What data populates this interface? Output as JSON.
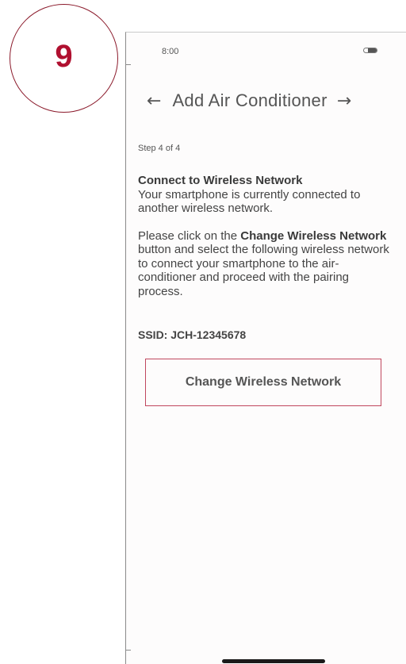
{
  "step_badge": {
    "number": "9"
  },
  "status_bar": {
    "time": "8:00"
  },
  "header": {
    "back_arrow": "←",
    "title": "Add Air Conditioner",
    "forward_arrow": "→"
  },
  "step_indicator": "Step 4 of 4",
  "content": {
    "heading": "Connect to Wireless Network",
    "intro": "Your smartphone is currently connected to another wireless network.",
    "para2_prefix": "Please click on the ",
    "para2_bold": "Change Wireless Network",
    "para2_suffix": " button and select the following wireless network to connect your smartphone to the air-conditioner and proceed with the pairing process."
  },
  "ssid": "SSID: JCH-12345678",
  "change_button_label": "Change Wireless Network",
  "colors": {
    "accent": "#b01030",
    "badge_border": "#8b1a2b",
    "button_border": "#c0475e"
  },
  "icons": [
    "battery-icon",
    "back-arrow-icon",
    "forward-arrow-icon"
  ]
}
